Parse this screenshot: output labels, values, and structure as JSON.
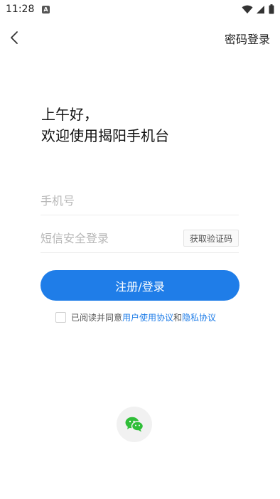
{
  "status_bar": {
    "time": "11:28",
    "notification_icon": "a-app-icon",
    "icons": [
      "wifi-icon",
      "signal-icon",
      "battery-icon"
    ]
  },
  "header": {
    "back_icon": "chevron-left-icon",
    "password_login_label": "密码登录"
  },
  "greeting": {
    "line1": "上午好，",
    "line2": "欢迎使用揭阳手机台"
  },
  "form": {
    "phone_placeholder": "手机号",
    "code_placeholder": "短信安全登录",
    "get_code_label": "获取验证码",
    "submit_label": "注册/登录"
  },
  "agreement": {
    "checked": false,
    "prefix": "已阅读并同意",
    "user_agreement": "用户使用协议",
    "and": "和",
    "privacy": "隐私协议"
  },
  "social": {
    "wechat_icon": "wechat-icon"
  },
  "colors": {
    "accent": "#1f7de8",
    "wechat_green": "#2fbe38"
  }
}
